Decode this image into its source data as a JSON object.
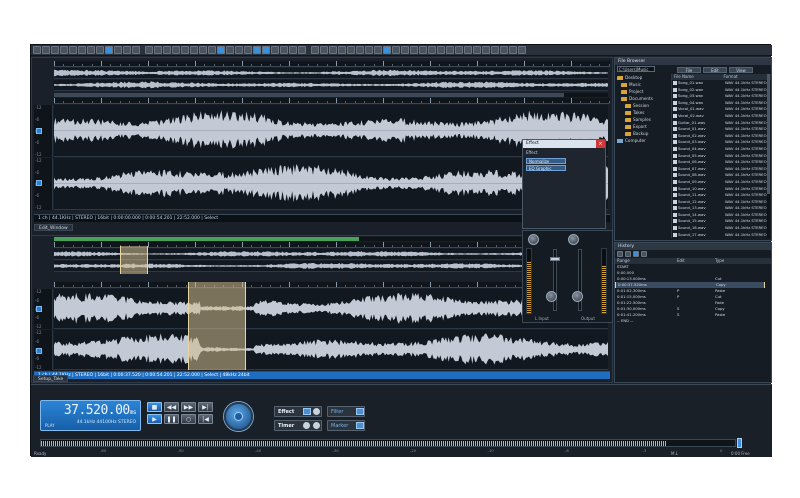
{
  "toolbar": {
    "button_count": 54
  },
  "editor_top": {
    "status_text": "1 ch | 44.1KHz | STEREO | 16bit | 0:00:00.000 | 0:00:54.201 | 22:52.000 | Select",
    "tab_label": "Edit_Window",
    "scale_labels_a": [
      "-12",
      "-6",
      "0",
      "-6",
      "-12"
    ],
    "scale_labels_b": [
      "-12",
      "-6",
      "0",
      "-6",
      "-12"
    ]
  },
  "editor_bottom": {
    "status_text": "1 ch | 44.1KHz | STEREO | 16bit | 0:00:37.520 | 0:00:54.201 | 22:52.000 | Select | 48kHz 24bit",
    "tab_label": "Setup_Take",
    "scale_labels_a": [
      "-12",
      "-6",
      "0",
      "-6",
      "-12"
    ],
    "scale_labels_b": [
      "-12",
      "-6",
      "0",
      "-6",
      "-12"
    ]
  },
  "effect_dialog": {
    "title": "Effect",
    "subtitle": "Effect",
    "items": [
      "Normalize",
      "EQ Graphic"
    ],
    "close_label": "×"
  },
  "mixer": {
    "left_label": "L Input",
    "right_label": "Output",
    "meter_left_level": 0.8,
    "meter_right_level": 0.75
  },
  "browser": {
    "title": "File Browser",
    "tabs": [
      "File",
      "Edit",
      "View"
    ],
    "path": "C:\\Users\\Music",
    "tree": [
      {
        "label": "Desktop",
        "type": "folder",
        "indent": 0
      },
      {
        "label": "Music",
        "type": "folder",
        "indent": 1
      },
      {
        "label": "Project",
        "type": "folder",
        "indent": 1
      },
      {
        "label": "Documents",
        "type": "folder",
        "indent": 1
      },
      {
        "label": "Session",
        "type": "folder",
        "indent": 2
      },
      {
        "label": "Takes",
        "type": "folder",
        "indent": 2
      },
      {
        "label": "Samples",
        "type": "folder",
        "indent": 2
      },
      {
        "label": "Export",
        "type": "folder",
        "indent": 2
      },
      {
        "label": "Backup",
        "type": "folder",
        "indent": 2
      },
      {
        "label": "Computer",
        "type": "pc",
        "indent": 0
      }
    ],
    "file_headers": [
      "File Name",
      "Format"
    ],
    "files": [
      {
        "name": "Song_01.wav",
        "format": "WAV 44.1kHz STEREO"
      },
      {
        "name": "Song_02.wav",
        "format": "WAV 44.1kHz STEREO"
      },
      {
        "name": "Song_03.wav",
        "format": "WAV 44.1kHz STEREO"
      },
      {
        "name": "Song_04.wav",
        "format": "WAV 44.1kHz STEREO"
      },
      {
        "name": "Vocal_01.wav",
        "format": "WAV 44.1kHz STEREO"
      },
      {
        "name": "Vocal_02.wav",
        "format": "WAV 44.1kHz STEREO"
      },
      {
        "name": "Guitar_01.wav",
        "format": "WAV 44.1kHz STEREO"
      },
      {
        "name": "Sound_01.wav",
        "format": "WAV 44.1kHz STEREO"
      },
      {
        "name": "Sound_02.wav",
        "format": "WAV 44.1kHz STEREO"
      },
      {
        "name": "Sound_03.wav",
        "format": "WAV 44.1kHz STEREO"
      },
      {
        "name": "Sound_04.wav",
        "format": "WAV 44.1kHz STEREO"
      },
      {
        "name": "Sound_05.wav",
        "format": "WAV 44.1kHz STEREO"
      },
      {
        "name": "Sound_06.wav",
        "format": "WAV 44.1kHz STEREO"
      },
      {
        "name": "Sound_07.wav",
        "format": "WAV 44.1kHz STEREO"
      },
      {
        "name": "Sound_08.wav",
        "format": "WAV 44.1kHz STEREO"
      },
      {
        "name": "Sound_09.wav",
        "format": "WAV 44.1kHz STEREO"
      },
      {
        "name": "Sound_10.wav",
        "format": "WAV 44.1kHz STEREO"
      },
      {
        "name": "Sound_11.wav",
        "format": "WAV 44.1kHz STEREO"
      },
      {
        "name": "Sound_12.wav",
        "format": "WAV 44.1kHz STEREO"
      },
      {
        "name": "Sound_13.wav",
        "format": "WAV 44.1kHz STEREO"
      },
      {
        "name": "Sound_14.wav",
        "format": "WAV 44.1kHz STEREO"
      },
      {
        "name": "Sound_15.wav",
        "format": "WAV 44.1kHz STEREO"
      },
      {
        "name": "Sound_16.wav",
        "format": "WAV 44.1kHz STEREO"
      },
      {
        "name": "Sound_17.wav",
        "format": "WAV 44.1kHz STEREO"
      }
    ]
  },
  "history": {
    "title": "History",
    "headers": [
      "Range",
      "Edit",
      "Type"
    ],
    "rows": [
      {
        "range": "START",
        "edit": "",
        "type": ""
      },
      {
        "range": "0:00.000",
        "edit": "",
        "type": ""
      },
      {
        "range": "0:00:13.000ms",
        "edit": "",
        "type": "Cut"
      },
      {
        "range": "0:00:37.520ms",
        "edit": "",
        "type": "Copy"
      },
      {
        "range": "0:00:41.800ms",
        "edit": "",
        "type": "Paste"
      },
      {
        "range": "0:01:02.300ms",
        "edit": "P",
        "type": "Paste"
      },
      {
        "range": "0:01:15.000ms",
        "edit": "P",
        "type": "Cut"
      },
      {
        "range": "0:01:22.500ms",
        "edit": "",
        "type": "Fade"
      },
      {
        "range": "0:01:30.000ms",
        "edit": "S",
        "type": "Copy"
      },
      {
        "range": "0:01:41.200ms",
        "edit": "S",
        "type": "Paste"
      },
      {
        "range": "-- END --",
        "edit": "",
        "type": ""
      }
    ],
    "selected_row": 3
  },
  "transport": {
    "time": "37.520.00",
    "time_unit": "ms",
    "format": "44.1kHz 44100Hz STEREO",
    "mode": "PLAY",
    "effect_label": "Effect",
    "timer_label": "Timer",
    "filter_label": "Filter",
    "marker_label": "Marker"
  },
  "peak_meter": {
    "level": 0.9,
    "labels": [
      "-60",
      "-50",
      "-40",
      "-30",
      "-20",
      "-10",
      "-6",
      "-3",
      "0"
    ]
  },
  "footer": {
    "left": "Ready",
    "mid": "M.L",
    "right": "0:00 Free"
  }
}
